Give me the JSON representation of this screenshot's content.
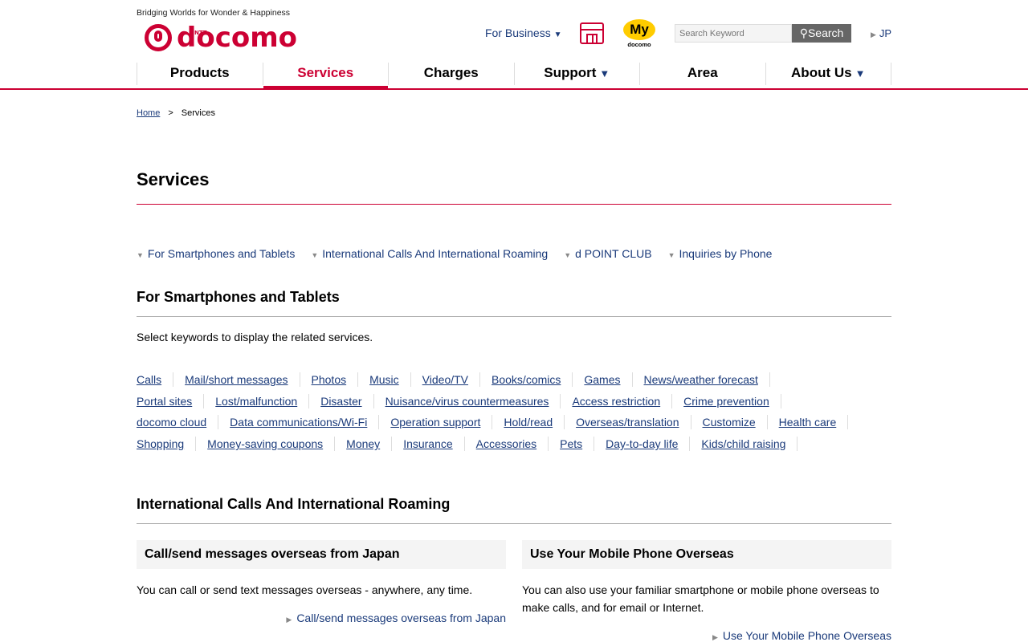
{
  "header": {
    "tagline": "Bridging Worlds for Wonder & Happiness",
    "logo_text": "docomo",
    "logo_sup": "NTT",
    "for_business": "For Business",
    "my_label": "My",
    "my_sub": "docomo",
    "search_placeholder": "Search Keyword",
    "search_button": "Search",
    "lang": "JP"
  },
  "nav": [
    {
      "label": "Products"
    },
    {
      "label": "Services"
    },
    {
      "label": "Charges"
    },
    {
      "label": "Support"
    },
    {
      "label": "Area"
    },
    {
      "label": "About Us"
    }
  ],
  "breadcrumb": {
    "home": "Home",
    "sep": ">",
    "current": "Services"
  },
  "page_title": "Services",
  "anchors": [
    "For Smartphones and Tablets",
    "International Calls And International Roaming",
    "d POINT CLUB",
    "Inquiries by Phone"
  ],
  "section1": {
    "title": "For Smartphones and Tablets",
    "lead": "Select keywords to display the related services.",
    "rows": [
      [
        "Calls",
        "Mail/short messages",
        "Photos",
        "Music",
        "Video/TV",
        "Books/comics",
        "Games",
        "News/weather forecast"
      ],
      [
        "Portal sites",
        "Lost/malfunction",
        "Disaster",
        "Nuisance/virus countermeasures",
        "Access restriction",
        "Crime prevention"
      ],
      [
        "docomo cloud",
        "Data communications/Wi-Fi",
        "Operation support",
        "Hold/read",
        "Overseas/translation",
        "Customize",
        "Health care"
      ],
      [
        "Shopping",
        "Money-saving coupons",
        "Money",
        "Insurance",
        "Accessories",
        "Pets",
        "Day-to-day life",
        "Kids/child raising"
      ]
    ]
  },
  "section2": {
    "title": "International Calls And International Roaming",
    "cards": [
      {
        "title": "Call/send messages overseas from Japan",
        "text": "You can call or send text messages overseas - anywhere, any time.",
        "link": "Call/send messages overseas from Japan"
      },
      {
        "title": "Use Your Mobile Phone Overseas",
        "text": "You can also use your familiar smartphone or mobile phone overseas to make calls, and for email or Internet.",
        "link": "Use Your Mobile Phone Overseas"
      }
    ]
  },
  "colors": {
    "brand": "#cc0033",
    "link": "#1a3a7a"
  }
}
